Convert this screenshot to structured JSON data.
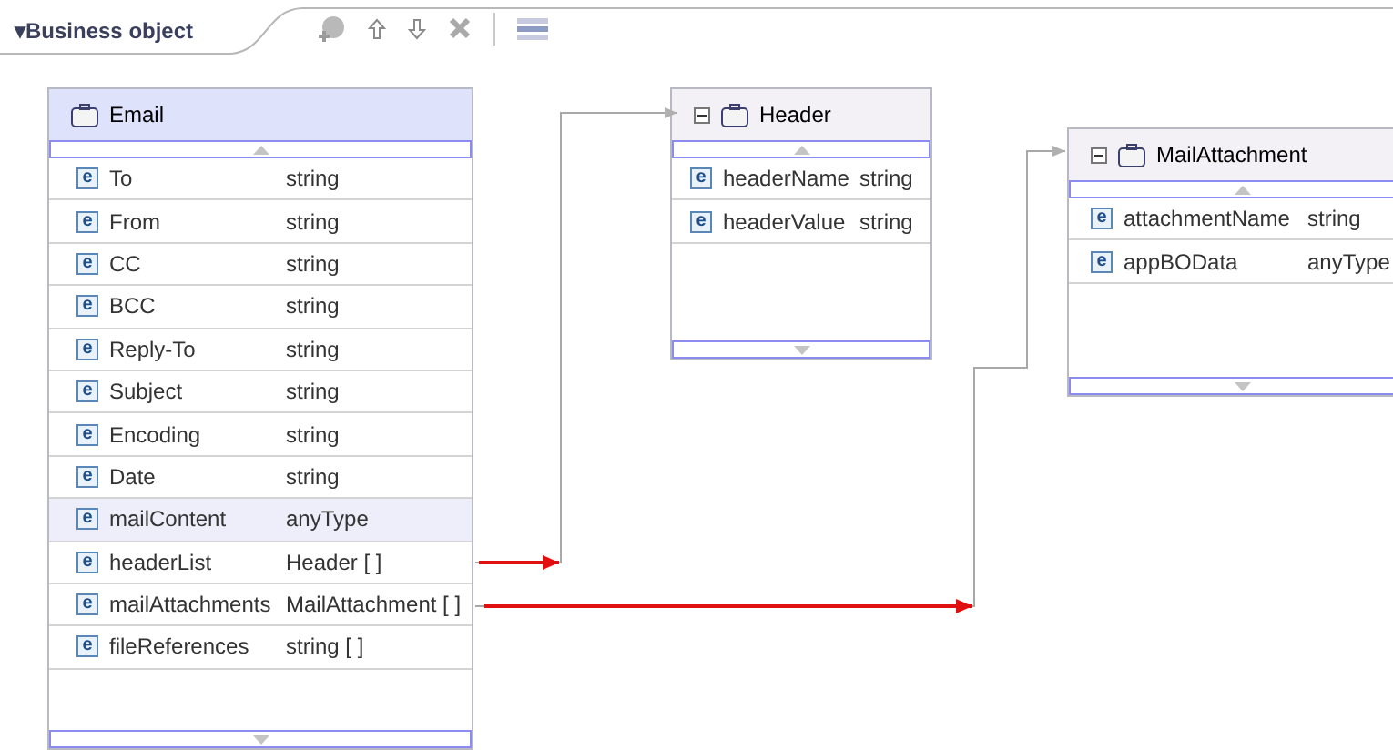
{
  "view": {
    "title": "Business object",
    "toggle": "▾"
  },
  "entities": [
    {
      "name": "Email",
      "collapsible": false,
      "fields": [
        {
          "marker": "e",
          "name": "To",
          "type": "string",
          "selected": false
        },
        {
          "marker": "e",
          "name": "From",
          "type": "string",
          "selected": false
        },
        {
          "marker": "e",
          "name": "CC",
          "type": "string",
          "selected": false
        },
        {
          "marker": "e",
          "name": "BCC",
          "type": "string",
          "selected": false
        },
        {
          "marker": "e",
          "name": "Reply-To",
          "type": "string",
          "selected": false
        },
        {
          "marker": "e",
          "name": "Subject",
          "type": "string",
          "selected": false
        },
        {
          "marker": "e",
          "name": "Encoding",
          "type": "string",
          "selected": false
        },
        {
          "marker": "e",
          "name": "Date",
          "type": "string",
          "selected": false
        },
        {
          "marker": "e",
          "name": "mailContent",
          "type": "anyType",
          "selected": true
        },
        {
          "marker": "e",
          "name": "headerList",
          "type": "Header [ ]",
          "selected": false
        },
        {
          "marker": "e",
          "name": "mailAttachments",
          "type": "MailAttachment [ ]",
          "selected": false
        },
        {
          "marker": "e",
          "name": "fileReferences",
          "type": "string [ ]",
          "selected": false
        }
      ]
    },
    {
      "name": "Header",
      "collapsible": true,
      "fields": [
        {
          "marker": "e",
          "name": "headerName",
          "type": "string",
          "selected": false
        },
        {
          "marker": "e",
          "name": "headerValue",
          "type": "string",
          "selected": false
        }
      ]
    },
    {
      "name": "MailAttachment",
      "collapsible": true,
      "fields": [
        {
          "marker": "e",
          "name": "attachmentName",
          "type": "string",
          "selected": false
        },
        {
          "marker": "e",
          "name": "appBOData",
          "type": "anyType",
          "selected": false
        }
      ]
    }
  ]
}
